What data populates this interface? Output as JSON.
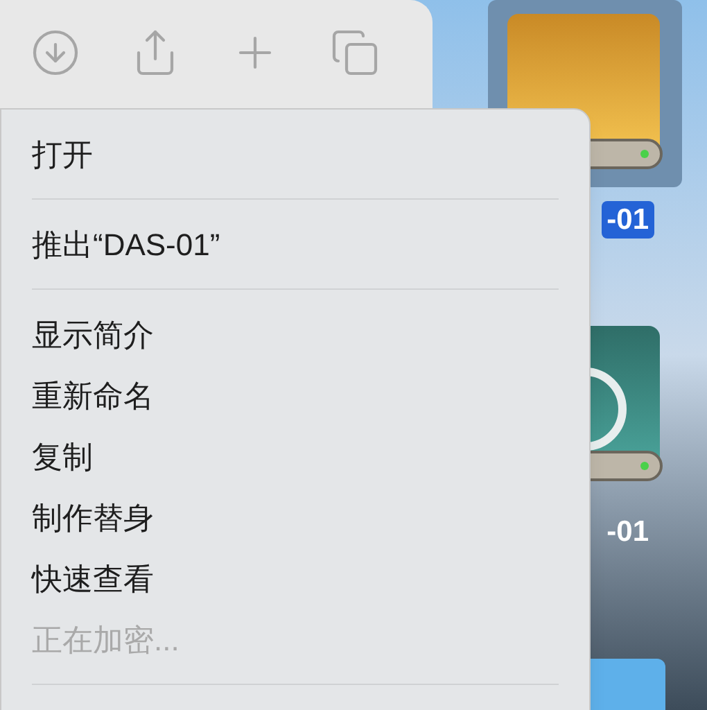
{
  "desktop_items": [
    {
      "kind": "drive",
      "label": "-01",
      "selected": true
    },
    {
      "kind": "drive-teal",
      "label": "-01",
      "selected": false
    },
    {
      "kind": "folder",
      "selected": false
    }
  ],
  "context_menu": {
    "sections": [
      {
        "items": [
          {
            "label": "打开",
            "disabled": false
          }
        ]
      },
      {
        "items": [
          {
            "label": "推出“DAS-01”",
            "disabled": false
          }
        ]
      },
      {
        "items": [
          {
            "label": "显示简介",
            "disabled": false
          },
          {
            "label": "重新命名",
            "disabled": false
          },
          {
            "label": "复制",
            "disabled": false
          },
          {
            "label": "制作替身",
            "disabled": false
          },
          {
            "label": "快速查看",
            "disabled": false
          },
          {
            "label": "正在加密...",
            "disabled": true
          }
        ]
      }
    ]
  }
}
